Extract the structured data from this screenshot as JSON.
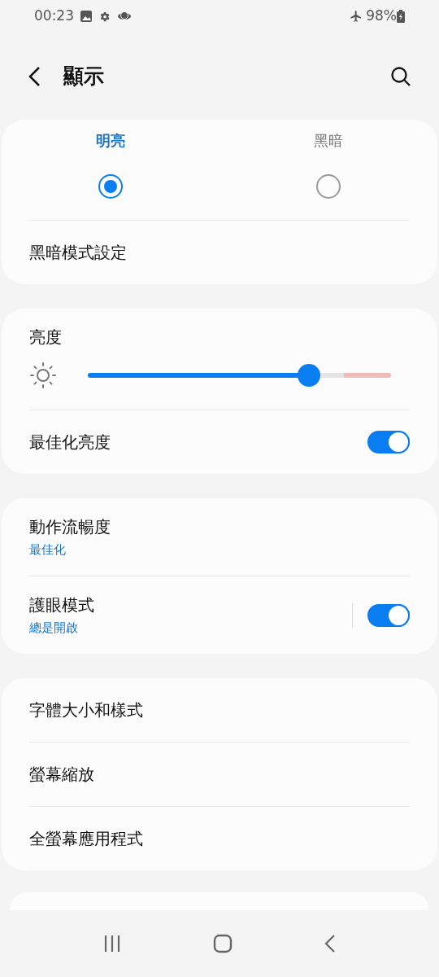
{
  "status_bar": {
    "time": "00:23",
    "battery": "98%"
  },
  "header": {
    "title": "顯示"
  },
  "theme_modes": [
    {
      "label": "明亮",
      "selected": true
    },
    {
      "label": "黑暗",
      "selected": false
    }
  ],
  "dark_mode_settings": {
    "label": "黑暗模式設定"
  },
  "brightness": {
    "label": "亮度",
    "level": 0.73
  },
  "adaptive_brightness": {
    "label": "最佳化亮度",
    "on": true
  },
  "motion_group": [
    {
      "label": "動作流暢度",
      "value": "最佳化",
      "kind": "link"
    },
    {
      "label": "護眼模式",
      "value": "總是開啟",
      "kind": "switch",
      "on": true
    }
  ],
  "font_group": [
    {
      "label": "字體大小和樣式"
    },
    {
      "label": "螢幕縮放"
    },
    {
      "label": "全螢幕應用程式"
    }
  ]
}
